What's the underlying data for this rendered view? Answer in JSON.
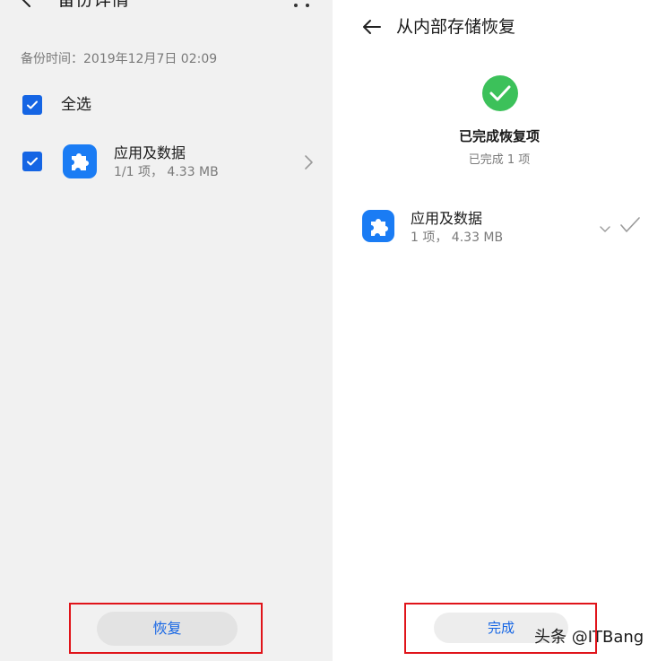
{
  "left": {
    "title": "备份详情",
    "backup_time": "备份时间：2019年12月7日 02:09",
    "select_all_label": "全选",
    "item": {
      "title": "应用及数据",
      "subtitle": "1/1 项，  4.33 MB"
    },
    "restore_label": "恢复"
  },
  "right": {
    "title": "从内部存储恢复",
    "done_title": "已完成恢复项",
    "done_count": "已完成 1 项",
    "item": {
      "title": "应用及数据",
      "subtitle": "1 项，  4.33 MB"
    },
    "finish_label": "完成",
    "watermark": "头条 @ITBang"
  },
  "colors": {
    "accent": "#1565e4",
    "app_icon": "#1a7cf4",
    "success": "#3cc15a",
    "highlight_box": "#e0141a"
  },
  "icons": [
    "back-arrow-icon",
    "more-icon",
    "checkbox-checked-icon",
    "puzzle-app-icon",
    "chevron-right-icon",
    "success-check-icon",
    "chevron-down-icon",
    "checkmark-icon"
  ]
}
